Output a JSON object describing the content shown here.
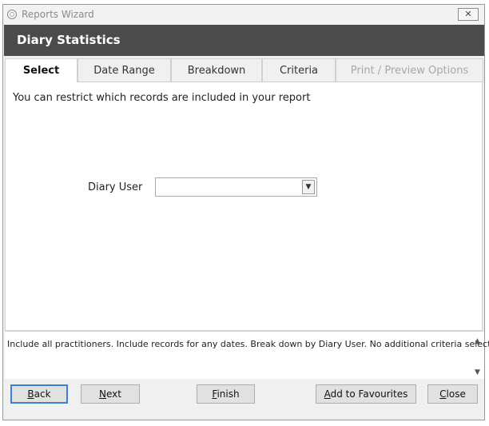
{
  "window": {
    "title": "Reports Wizard",
    "header_title": "Diary Statistics",
    "close_glyph": "✕"
  },
  "tabs": [
    {
      "label": "Select",
      "state": "active"
    },
    {
      "label": "Date Range",
      "state": "normal"
    },
    {
      "label": "Breakdown",
      "state": "normal"
    },
    {
      "label": "Criteria",
      "state": "normal"
    },
    {
      "label": "Print / Preview Options",
      "state": "disabled"
    }
  ],
  "select_panel": {
    "instruction": "You can restrict which records are included in your report",
    "diary_user_label": "Diary User",
    "diary_user_value": "",
    "dropdown_glyph": "▼"
  },
  "summary": {
    "text": "Include all practitioners. Include records for any dates. Break down by Diary User. No additional criteria selected",
    "scroll_up_glyph": "▲",
    "scroll_down_glyph": "▼"
  },
  "buttons": {
    "back": {
      "mnemonic": "B",
      "rest": "ack"
    },
    "next": {
      "mnemonic": "N",
      "rest": "ext"
    },
    "finish": {
      "mnemonic": "F",
      "rest": "inish"
    },
    "add_favourites": {
      "mnemonic": "A",
      "rest": "dd to Favourites"
    },
    "close": {
      "mnemonic": "C",
      "rest": "lose"
    }
  },
  "colors": {
    "header_band": "#4b4b4b",
    "focus_border": "#3c7fd4",
    "disabled_text": "#a8a8a8"
  }
}
